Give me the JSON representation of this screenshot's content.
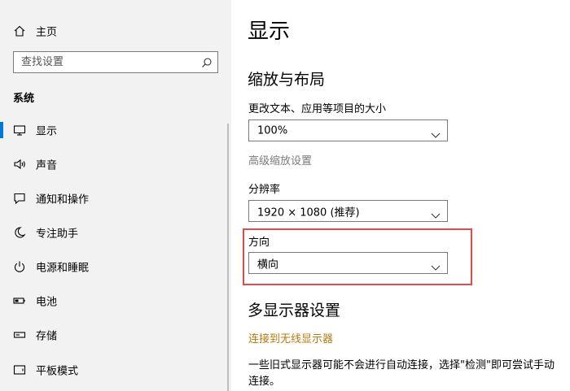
{
  "sidebar": {
    "home_label": "主页",
    "search_placeholder": "查找设置",
    "section_title": "系统",
    "items": [
      {
        "label": "显示",
        "icon": "monitor-icon"
      },
      {
        "label": "声音",
        "icon": "speaker-icon"
      },
      {
        "label": "通知和操作",
        "icon": "notification-icon"
      },
      {
        "label": "专注助手",
        "icon": "moon-icon"
      },
      {
        "label": "电源和睡眠",
        "icon": "power-icon"
      },
      {
        "label": "电池",
        "icon": "battery-icon"
      },
      {
        "label": "存储",
        "icon": "storage-icon"
      },
      {
        "label": "平板模式",
        "icon": "tablet-icon"
      }
    ],
    "active_index": 0
  },
  "main": {
    "title": "显示",
    "scale_section": "缩放与布局",
    "scale_label": "更改文本、应用等项目的大小",
    "scale_value": "100%",
    "advanced_scale_link": "高级缩放设置",
    "resolution_label": "分辨率",
    "resolution_value": "1920 × 1080 (推荐)",
    "orientation_label": "方向",
    "orientation_value": "横向",
    "multi_display_section": "多显示器设置",
    "wireless_link": "连接到无线显示器",
    "description": "一些旧式显示器可能不会进行自动连接，选择\"检测\"即可尝试手动连接。"
  },
  "colors": {
    "accent": "#0078d7",
    "highlight": "#e04b4b",
    "link": "#b67b10"
  }
}
